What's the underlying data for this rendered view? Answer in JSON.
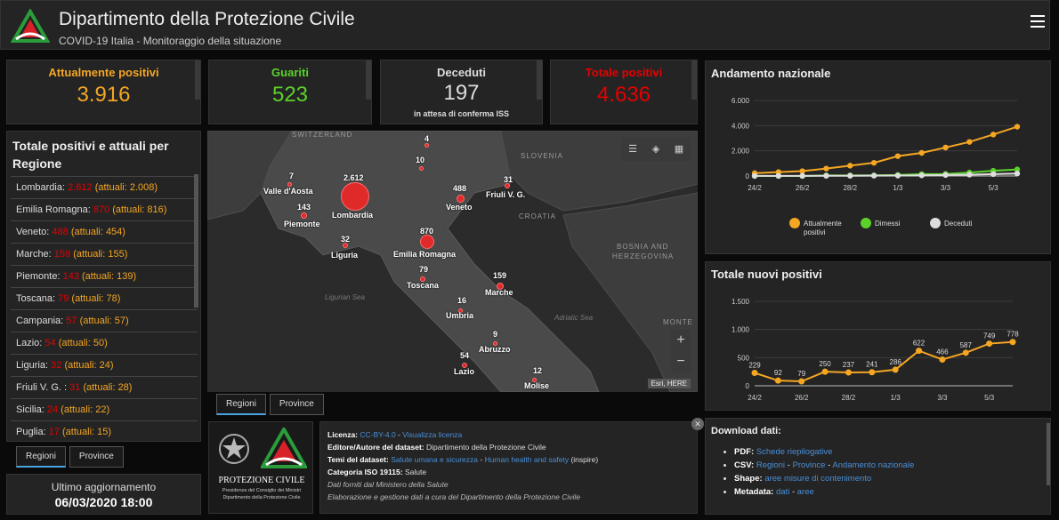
{
  "header": {
    "title": "Dipartimento della Protezione Civile",
    "subtitle": "COVID-19 Italia - Monitoraggio della situazione"
  },
  "stats": [
    {
      "label": "Attualmente positivi",
      "value": "3.916",
      "color": "#f5a623"
    },
    {
      "label": "Guariti",
      "value": "523",
      "color": "#5bd22a"
    },
    {
      "label": "Deceduti",
      "value": "197",
      "color": "#dddddd",
      "note": "in attesa di conferma ISS"
    },
    {
      "label": "Totale positivi",
      "value": "4.636",
      "color": "#e60000"
    }
  ],
  "regions_panel": {
    "title": "Totale positivi e attuali per Regione",
    "items": [
      {
        "name": "Lombardia:",
        "total": "2.612",
        "current": "(attuali: 2.008)"
      },
      {
        "name": "Emilia Romagna:",
        "total": "870",
        "current": "(attuali: 816)"
      },
      {
        "name": "Veneto:",
        "total": "488",
        "current": "(attuali: 454)"
      },
      {
        "name": "Marche:",
        "total": "159",
        "current": "(attuali: 155)"
      },
      {
        "name": "Piemonte:",
        "total": "143",
        "current": "(attuali: 139)"
      },
      {
        "name": "Toscana:",
        "total": "79",
        "current": "(attuali: 78)"
      },
      {
        "name": "Campania:",
        "total": "57",
        "current": "(attuali: 57)"
      },
      {
        "name": "Lazio:",
        "total": "54",
        "current": "(attuali: 50)"
      },
      {
        "name": "Liguria:",
        "total": "32",
        "current": "(attuali: 24)"
      },
      {
        "name": "Friuli V. G. :",
        "total": "31",
        "current": "(attuali: 28)"
      },
      {
        "name": "Sicilia:",
        "total": "24",
        "current": "(attuali: 22)"
      },
      {
        "name": "Puglia:",
        "total": "17",
        "current": "(attuali: 15)"
      }
    ],
    "tabs": [
      "Regioni",
      "Province"
    ]
  },
  "updated": {
    "label": "Ultimo aggiornamento",
    "value": "06/03/2020 18:00"
  },
  "map": {
    "tabs": [
      "Regioni",
      "Province"
    ],
    "geo": {
      "switzerland": "SWITZERLAND",
      "slovenia": "SLOVENIA",
      "croatia": "CROATIA",
      "bosnia1": "BOSNIA AND",
      "bosnia2": "HERZEGOVINA",
      "montenegro": "MONTE"
    },
    "seas": {
      "ligurian": "Ligurian Sea",
      "adriatic": "Adriatic Sea"
    },
    "attribution": "Esri, HERE",
    "labels": [
      {
        "num": "4",
        "name": ""
      },
      {
        "num": "10",
        "name": ""
      },
      {
        "num": "7",
        "name": "Valle d'Aosta"
      },
      {
        "num": "2.612",
        "name": "Lombardia"
      },
      {
        "num": "488",
        "name": "Veneto"
      },
      {
        "num": "31",
        "name": "Friuli V. G."
      },
      {
        "num": "143",
        "name": "Piemonte"
      },
      {
        "num": "32",
        "name": "Liguria"
      },
      {
        "num": "870",
        "name": "Emilia Romagna"
      },
      {
        "num": "79",
        "name": "Toscana"
      },
      {
        "num": "159",
        "name": "Marche"
      },
      {
        "num": "16",
        "name": "Umbria"
      },
      {
        "num": "9",
        "name": "Abruzzo"
      },
      {
        "num": "54",
        "name": "Lazio"
      },
      {
        "num": "12",
        "name": "Molise"
      }
    ]
  },
  "logo_box": {
    "line1": "PROTEZIONE CIVILE",
    "line2": "Presidenza del Consiglio dei Ministri",
    "line3": "Dipartimento della Protezione Civile"
  },
  "info": {
    "licenza_k": "Licenza:",
    "licenza_v": "CC-BY-4.0",
    "licenza_link": "Visualizza licenza",
    "editore_k": "Editore/Autore del dataset:",
    "editore_v": "Dipartimento della Protezione Civile",
    "temi_k": "Temi del dataset:",
    "temi_v1": "Salute umana e sicurezza",
    "temi_v2": "Human health and safety",
    "temi_v3": "(inspire)",
    "cat_k": "Categoria ISO 19115:",
    "cat_v": "Salute",
    "line5": "Dati forniti dal Ministero della Salute",
    "line6": "Elaborazione e gestione dati a cura del Dipartimento della Protezione Civile"
  },
  "chart_data": [
    {
      "type": "line",
      "title": "Andamento nazionale",
      "x": [
        "24/2",
        "25/2",
        "26/2",
        "27/2",
        "28/2",
        "29/2",
        "1/3",
        "2/3",
        "3/3",
        "4/3",
        "5/3",
        "6/3"
      ],
      "x_tick_labels": [
        "24/2",
        "26/2",
        "28/2",
        "1/3",
        "3/3",
        "5/3"
      ],
      "y_ticks": [
        "6.000",
        "4.000",
        "2.000",
        "0"
      ],
      "ylim": [
        0,
        6000
      ],
      "series": [
        {
          "name": "Attualmente positivi",
          "color": "#f5a623",
          "values": [
            221,
            311,
            385,
            588,
            821,
            1049,
            1577,
            1835,
            2263,
            2706,
            3296,
            3916
          ]
        },
        {
          "name": "Dimessi",
          "color": "#5bd22a",
          "values": [
            1,
            1,
            3,
            45,
            46,
            50,
            83,
            149,
            160,
            276,
            414,
            523
          ]
        },
        {
          "name": "Deceduti",
          "color": "#dddddd",
          "values": [
            7,
            10,
            12,
            17,
            21,
            29,
            34,
            52,
            79,
            107,
            148,
            197
          ]
        }
      ]
    },
    {
      "type": "line",
      "title": "Totale nuovi positivi",
      "x": [
        "24/2",
        "25/2",
        "26/2",
        "27/2",
        "28/2",
        "29/2",
        "1/3",
        "2/3",
        "3/3",
        "4/3",
        "5/3",
        "6/3"
      ],
      "x_tick_labels": [
        "24/2",
        "26/2",
        "28/2",
        "1/3",
        "3/3",
        "5/3"
      ],
      "y_ticks": [
        "1.500",
        "1.000",
        "500",
        "0"
      ],
      "ylim": [
        0,
        1500
      ],
      "series": [
        {
          "color": "#f5a623",
          "values": [
            229,
            92,
            79,
            250,
            237,
            241,
            286,
            622,
            466,
            587,
            749,
            778
          ],
          "labels": [
            "229",
            "92",
            "79",
            "250",
            "237",
            "241",
            "286",
            "622",
            "466",
            "587",
            "749",
            "778"
          ]
        }
      ]
    }
  ],
  "download": {
    "title": "Download dati:",
    "pdf_k": "PDF:",
    "pdf_1": "Schede riepilogative",
    "csv_k": "CSV:",
    "csv_1": "Regioni",
    "csv_2": "Province",
    "csv_3": "Andamento nazionale",
    "shape_k": "Shape:",
    "shape_1": "aree misure di contenimento",
    "meta_k": "Metadata:",
    "meta_1": "dati",
    "meta_2": "aree",
    "sep": " - "
  }
}
